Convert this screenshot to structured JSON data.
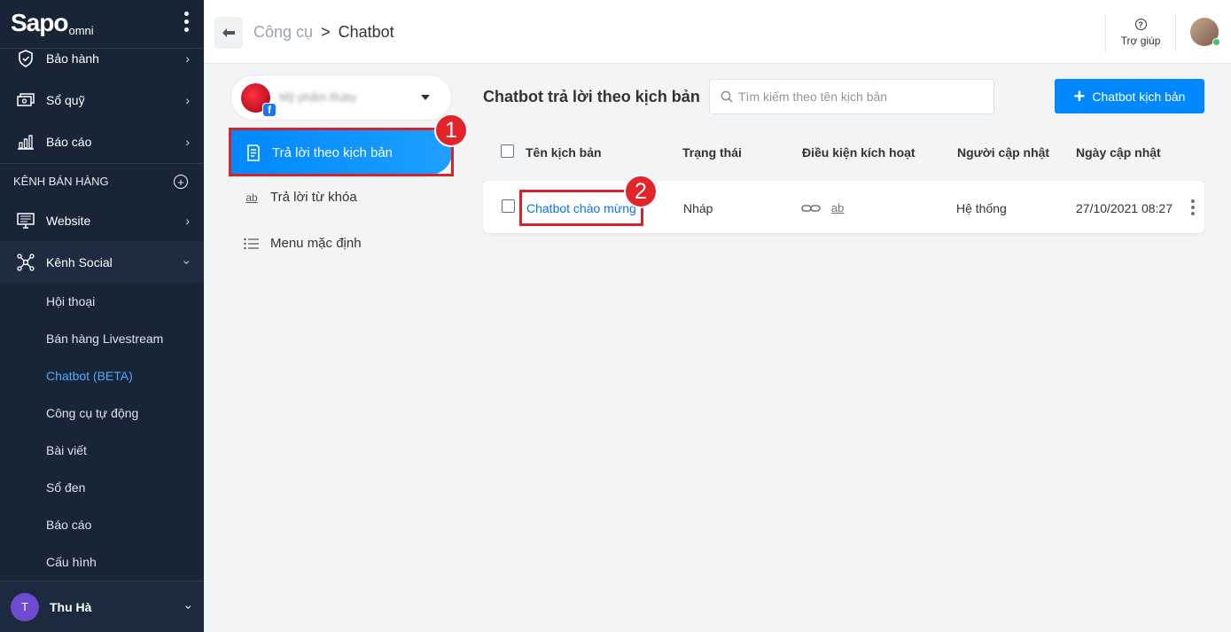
{
  "sidebar": {
    "logo_main": "Sapo",
    "logo_sub": "omni",
    "items": [
      {
        "label": "Bảo hành",
        "icon": "shield-icon"
      },
      {
        "label": "Sổ quỹ",
        "icon": "cash-icon"
      },
      {
        "label": "Báo cáo",
        "icon": "bar-chart-icon"
      }
    ],
    "section_label": "KÊNH BÁN HÀNG",
    "channels": [
      {
        "label": "Website",
        "icon": "website-icon"
      },
      {
        "label": "Kênh Social",
        "icon": "social-network-icon"
      }
    ],
    "social_sub_items": [
      "Hội thoại",
      "Bán hàng Livestream",
      "Chatbot (BETA)",
      "Công cụ tự động",
      "Bài viết",
      "Sổ đen",
      "Báo cáo",
      "Cấu hình"
    ],
    "active_sub_item": "Chatbot (BETA)",
    "user": {
      "initial": "T",
      "name": "Thu Hà"
    }
  },
  "header": {
    "breadcrumb_parent": "Công cụ",
    "breadcrumb_sep": ">",
    "breadcrumb_current": "Chatbot",
    "help_label": "Trợ giúp"
  },
  "page_selector": {
    "name": "Mỹ phẩm Ruby",
    "fb_badge": "f"
  },
  "left_menu": {
    "items": [
      {
        "label": "Trả lời theo kịch bản",
        "icon": "script-document-icon",
        "active": true
      },
      {
        "label": "Trả lời từ khóa",
        "icon": "keyword-ab-icon",
        "active": false
      },
      {
        "label": "Menu mặc định",
        "icon": "menu-list-icon",
        "active": false
      }
    ]
  },
  "main": {
    "title": "Chatbot trả lời theo kịch bản",
    "search_placeholder": "Tìm kiếm theo tên kịch bản",
    "add_button_label": "Chatbot kịch bản",
    "columns": [
      "Tên kịch bản",
      "Trạng thái",
      "Điều kiện kích hoạt",
      "Người cập nhật",
      "Ngày cập nhật"
    ],
    "rows": [
      {
        "name": "Chatbot chào mừng",
        "status": "Nháp",
        "trigger_icons": [
          "link-icon",
          "keyword-ab-icon"
        ],
        "trigger_ab_text": "ab",
        "updated_by": "Hệ thống",
        "updated_at": "27/10/2021 08:27"
      }
    ]
  },
  "annotations": {
    "badge_1": "1",
    "badge_2": "2",
    "highlight_color": "#d3242b"
  },
  "colors": {
    "sidebar_bg": "#182537",
    "accent": "#0088ff",
    "active_sub": "#4ea9ff",
    "link": "#0b74e6"
  }
}
